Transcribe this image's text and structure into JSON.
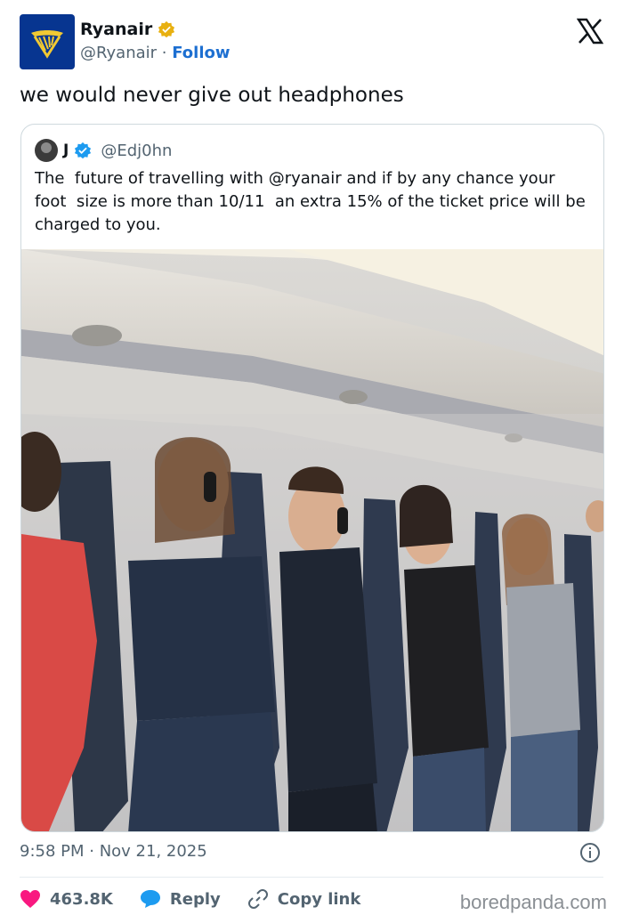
{
  "author": {
    "name": "Ryanair",
    "handle": "@Ryanair",
    "separator": " · ",
    "follow_label": "Follow",
    "verified_color": "#e8b010",
    "logo_icon": "ryanair-harp-logo"
  },
  "tweet": {
    "text": "we would never give out headphones",
    "timestamp": "9:58 PM · Nov 21, 2025"
  },
  "quoted_tweet": {
    "name": "J",
    "handle": "@Edj0hn",
    "text": "The  future of travelling with @ryanair and if by any chance your foot  size is more than 10/11  an extra 15% of the ticket price will be charged to you.",
    "verified_color": "#1d9bf0"
  },
  "actions": {
    "likes": "463.8K",
    "reply_label": "Reply",
    "copy_link_label": "Copy link",
    "like_color": "#f91880",
    "reply_color": "#1d9bf0"
  },
  "watermark": "boredpanda.com"
}
